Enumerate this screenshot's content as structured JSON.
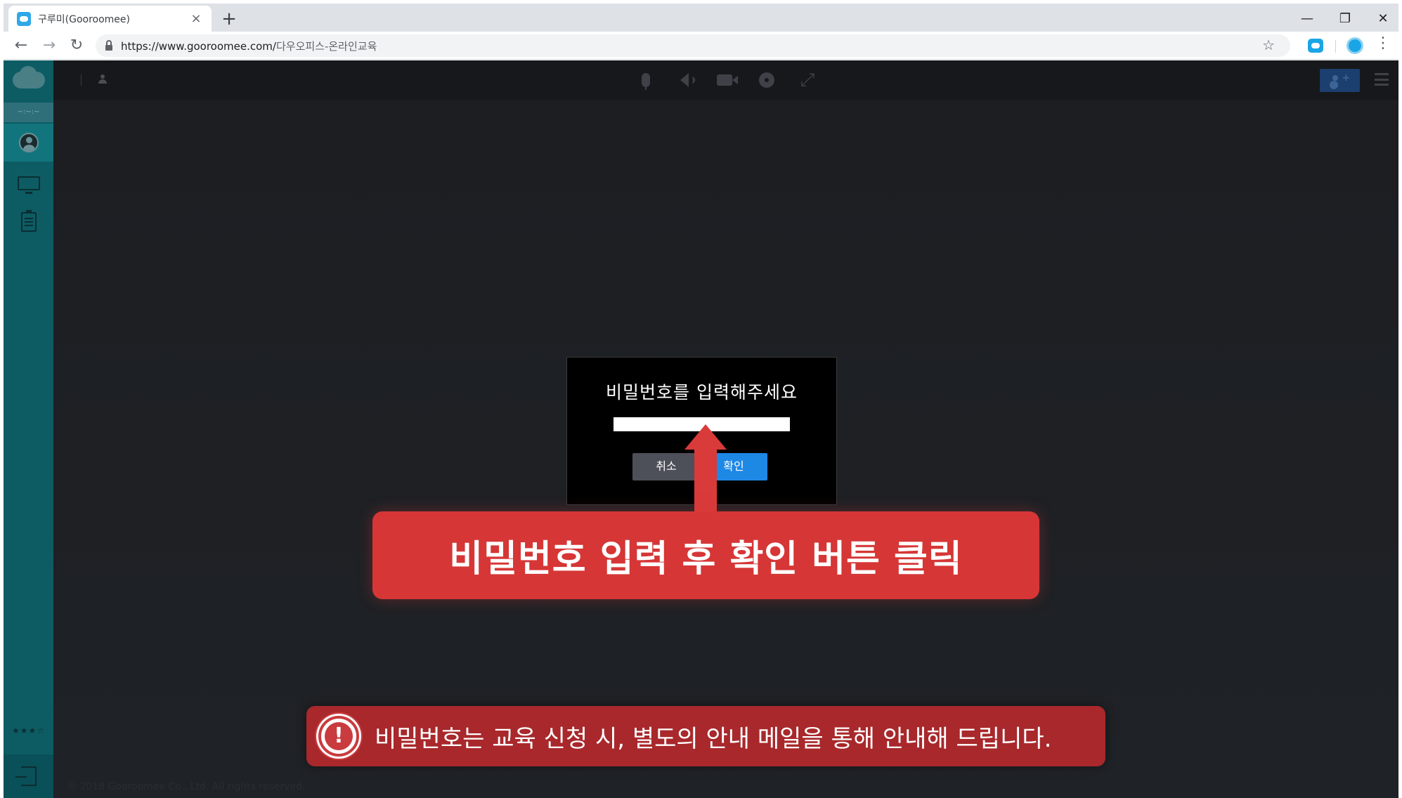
{
  "browser": {
    "tab_title": "구루미(Gooroomee)",
    "tab_close": "×",
    "new_tab": "+",
    "url_host": "https://www.gooroomee.com/",
    "url_path": "다우오피스-온라인교육",
    "back": "←",
    "forward": "→",
    "reload": "↻",
    "star": "☆",
    "menu": "⋮",
    "minimize": "—",
    "restore": "❐",
    "close": "✕"
  },
  "sidebar": {
    "strip_text": "~:~:~",
    "stars": "★★★☆",
    "items": [
      {
        "icon": "user-circle-icon"
      },
      {
        "icon": "monitor-icon"
      },
      {
        "icon": "clipboard-icon"
      }
    ]
  },
  "topbar": {
    "expand_glyph": "⤢"
  },
  "dialog": {
    "title": "비밀번호를 입력해주세요",
    "input_value": "",
    "cancel_label": "취소",
    "confirm_label": "확인"
  },
  "footer": {
    "copyright": "© 2018 Gooroomee Co., Ltd. All rights reserved."
  },
  "annotations": {
    "main_callout": "비밀번호 입력 후 확인 버튼 클릭",
    "note_text": "비밀번호는 교육 신청 시, 별도의 안내 메일을 통해 안내해 드립니다.",
    "note_badge": "!"
  },
  "colors": {
    "sidebar": "#0d5c63",
    "confirm_button": "#1e88e5",
    "callout_red": "#d63636",
    "note_red": "#a8282b"
  }
}
